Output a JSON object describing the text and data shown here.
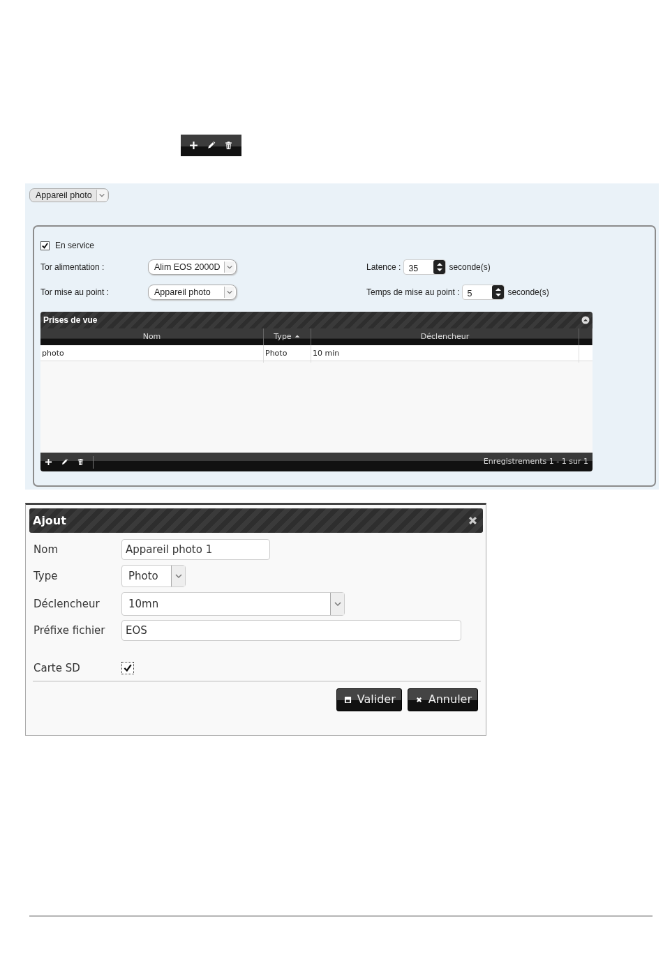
{
  "device_select": {
    "value": "Appareil photo"
  },
  "settings": {
    "in_service": {
      "label": "En service",
      "checked": true
    },
    "fields_left": [
      {
        "label": "Tor alimentation :",
        "value": "Alim EOS 2000D"
      },
      {
        "label": "Tor mise au point :",
        "value": "Appareil photo"
      }
    ],
    "fields_right": [
      {
        "label": "Latence :",
        "value": "35",
        "unit": "seconde(s)"
      },
      {
        "label": "Temps de mise au point :",
        "value": "5",
        "unit": "seconde(s)"
      }
    ]
  },
  "grid": {
    "title": "Prises de vue",
    "columns": [
      {
        "label": "Nom",
        "sorted": false
      },
      {
        "label": "Type",
        "sorted": true
      },
      {
        "label": "Déclencheur",
        "sorted": false
      }
    ],
    "rows": [
      [
        "photo",
        "Photo",
        "10 min"
      ]
    ],
    "footer": "Enregistrements 1 - 1 sur 1"
  },
  "dialog": {
    "title": "Ajout",
    "fields": [
      {
        "kind": "text",
        "label": "Nom",
        "value": "Appareil photo 1"
      },
      {
        "kind": "select",
        "label": "Type",
        "value": "Photo"
      },
      {
        "kind": "select",
        "label": "Déclencheur",
        "value": "10mn"
      },
      {
        "kind": "text",
        "label": "Préfixe fichier",
        "value": "EOS"
      },
      {
        "kind": "checkbox",
        "label": "Carte SD",
        "checked": true
      }
    ],
    "buttons": [
      {
        "label": "Valider",
        "kind": "save"
      },
      {
        "label": "Annuler",
        "kind": "cancel"
      }
    ]
  }
}
